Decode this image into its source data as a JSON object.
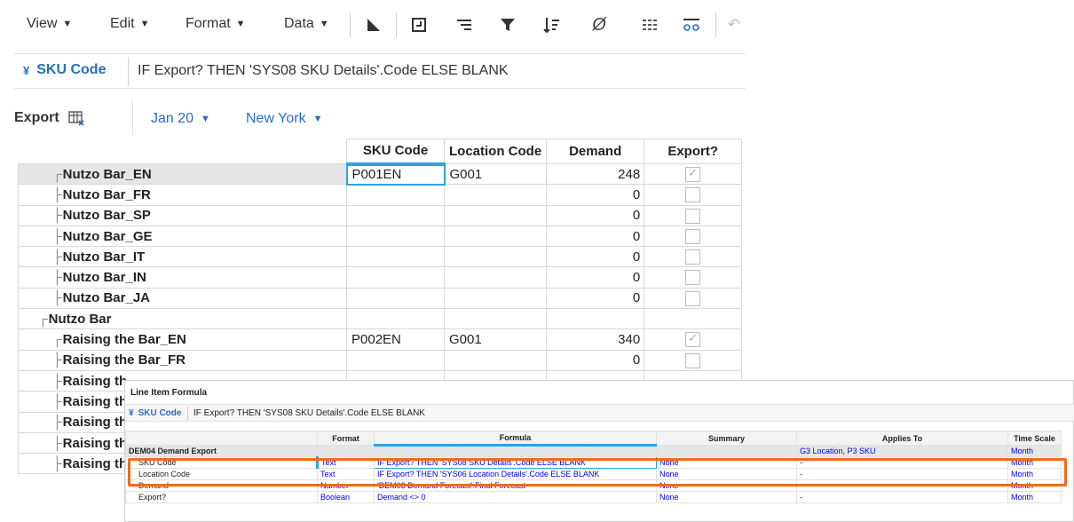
{
  "toolbar": {
    "menus": [
      {
        "label": "View"
      },
      {
        "label": "Edit"
      },
      {
        "label": "Format"
      },
      {
        "label": "Data"
      }
    ],
    "icons": [
      "pivot-icon",
      "freeze-icon",
      "indent-icon",
      "filter-icon",
      "sort-icon",
      "zero-suppress-icon",
      "grid-format-icon",
      "compare-icon",
      "undo-icon"
    ]
  },
  "formula_bar": {
    "line_item": "SKU Code",
    "formula": "IF Export? THEN 'SYS08 SKU Details'.Code ELSE BLANK"
  },
  "module": {
    "title": "Export",
    "context": [
      {
        "label": "Jan 20"
      },
      {
        "label": "New York"
      }
    ]
  },
  "grid": {
    "columns": [
      "SKU Code",
      "Location Code",
      "Demand",
      "Export?"
    ],
    "rows": [
      {
        "label": "Nutzo Bar_EN",
        "tree": "┌",
        "sku": "P001EN",
        "loc": "G001",
        "demand": "248",
        "export": true
      },
      {
        "label": "Nutzo Bar_FR",
        "tree": "├",
        "sku": "",
        "loc": "",
        "demand": "0",
        "export": false
      },
      {
        "label": "Nutzo Bar_SP",
        "tree": "├",
        "sku": "",
        "loc": "",
        "demand": "0",
        "export": false
      },
      {
        "label": "Nutzo Bar_GE",
        "tree": "├",
        "sku": "",
        "loc": "",
        "demand": "0",
        "export": false
      },
      {
        "label": "Nutzo Bar_IT",
        "tree": "├",
        "sku": "",
        "loc": "",
        "demand": "0",
        "export": false
      },
      {
        "label": "Nutzo Bar_IN",
        "tree": "├",
        "sku": "",
        "loc": "",
        "demand": "0",
        "export": false
      },
      {
        "label": "Nutzo Bar_JA",
        "tree": "├",
        "sku": "",
        "loc": "",
        "demand": "0",
        "export": false
      },
      {
        "label": "Nutzo Bar",
        "tree": "┌",
        "sku": "",
        "loc": "",
        "demand": "",
        "export": null
      },
      {
        "label": "Raising the Bar_EN",
        "tree": "┌",
        "sku": "P002EN",
        "loc": "G001",
        "demand": "340",
        "export": true
      },
      {
        "label": "Raising the Bar_FR",
        "tree": "├",
        "sku": "",
        "loc": "",
        "demand": "0",
        "export": false
      },
      {
        "label": "Raising th",
        "tree": "├",
        "sku": "",
        "loc": "",
        "demand": "",
        "export": null
      },
      {
        "label": "Raising th",
        "tree": "├",
        "sku": "",
        "loc": "",
        "demand": "",
        "export": null
      },
      {
        "label": "Raising th",
        "tree": "├",
        "sku": "",
        "loc": "",
        "demand": "",
        "export": null
      },
      {
        "label": "Raising th",
        "tree": "├",
        "sku": "",
        "loc": "",
        "demand": "",
        "export": null
      },
      {
        "label": "Raising th",
        "tree": "├",
        "sku": "",
        "loc": "",
        "demand": "",
        "export": null
      }
    ]
  },
  "popup": {
    "title": "Line Item Formula",
    "line_item": "SKU Code",
    "formula": "IF Export? THEN 'SYS08 SKU Details'.Code ELSE BLANK",
    "headers": [
      "",
      "Format",
      "Formula",
      "Summary",
      "Applies To",
      "Time Scale"
    ],
    "module_row": {
      "name": "DEM04 Demand Export",
      "applies_to": "G3 Location, P3 SKU",
      "time_scale": "Month"
    },
    "rows": [
      {
        "name": "SKU Code",
        "format": "Text",
        "formula": "IF Export? THEN 'SYS08 SKU Details'.Code ELSE BLANK",
        "summary": "None",
        "applies_to": "-",
        "time_scale": "Month"
      },
      {
        "name": "Location Code",
        "format": "Text",
        "formula": "IF Export? THEN 'SYS06 Location Details'.Code ELSE BLANK",
        "summary": "None",
        "applies_to": "-",
        "time_scale": "Month"
      },
      {
        "name": "Demand",
        "format": "Number",
        "formula": "'DEM03 Demand Forecast'.Final Forecast",
        "summary": "None",
        "applies_to": "-",
        "time_scale": "Month"
      },
      {
        "name": "Export?",
        "format": "Boolean",
        "formula": "Demand <> 0",
        "summary": "None",
        "applies_to": "-",
        "time_scale": "Month"
      }
    ]
  },
  "colors": {
    "accent": "#2a6ebb",
    "highlight": "#f26a1b",
    "selection": "#2ea3e2"
  }
}
